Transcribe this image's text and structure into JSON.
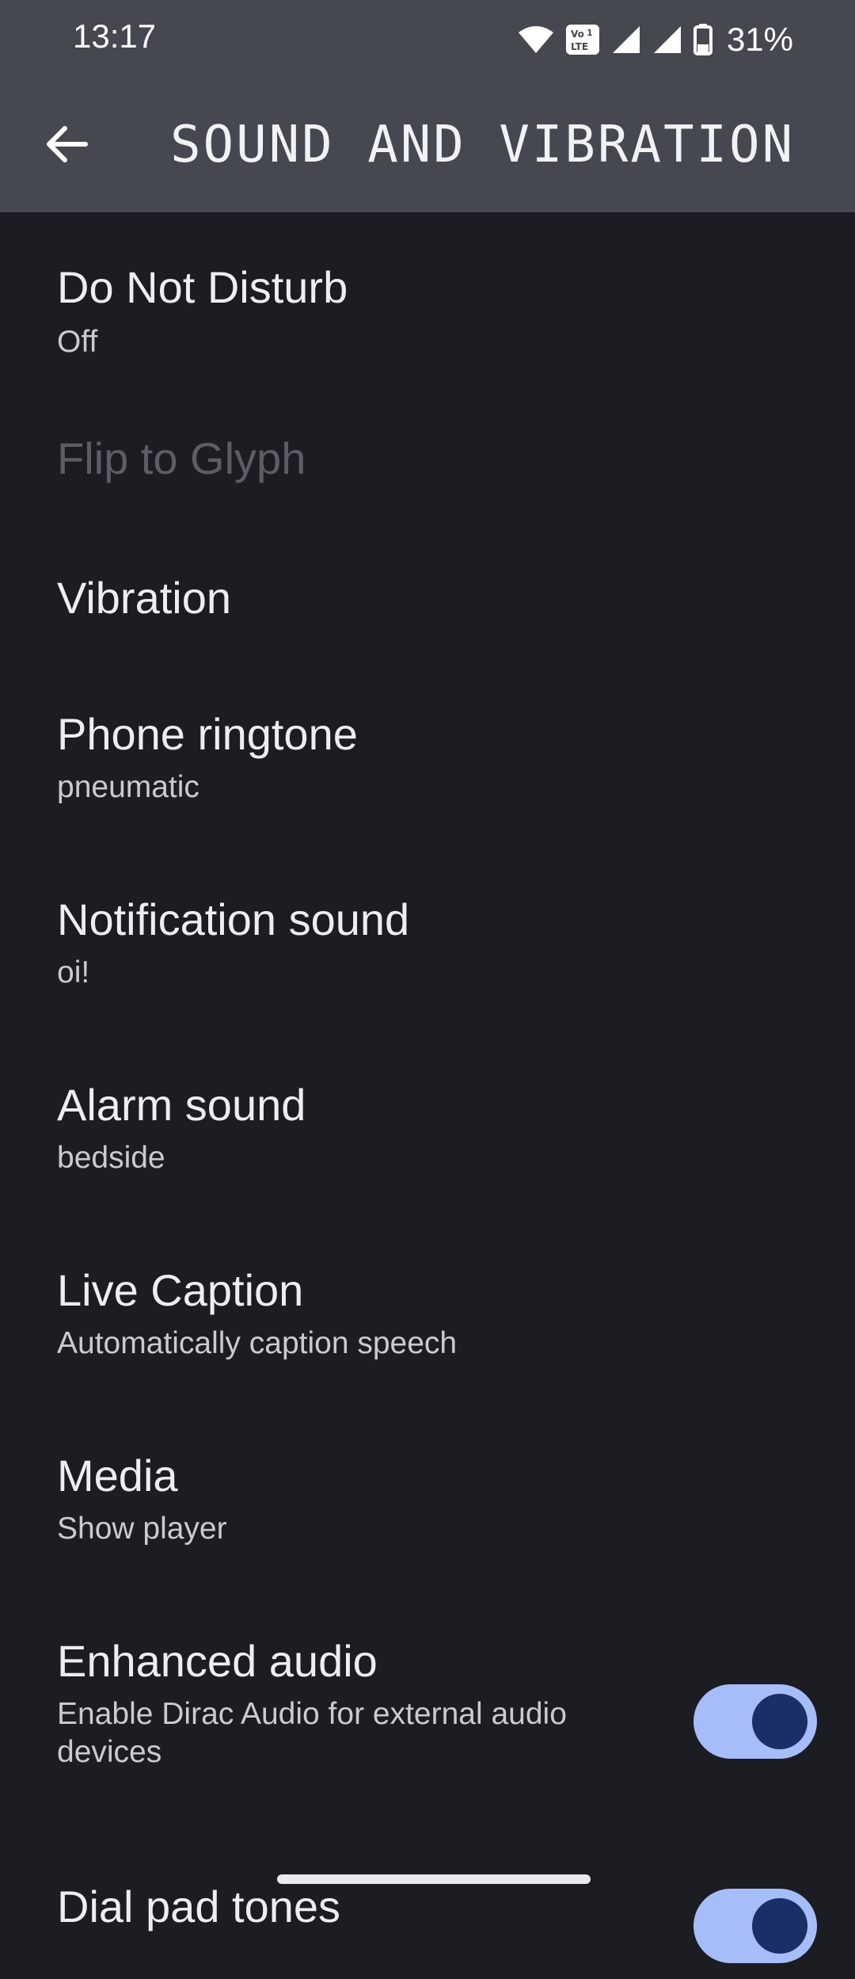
{
  "status_bar": {
    "time": "13:17",
    "battery": "31%",
    "icons": [
      "wifi-icon",
      "volte-icon",
      "signal-icon",
      "signal-icon",
      "battery-icon"
    ]
  },
  "app_bar": {
    "title": "SOUND AND VIBRATION",
    "back_icon": "arrow-left-icon"
  },
  "items": [
    {
      "title": "Do Not Disturb",
      "subtitle": "Off"
    },
    {
      "title": "Flip to Glyph",
      "disabled": true
    },
    {
      "title": "Vibration"
    },
    {
      "title": "Phone ringtone",
      "subtitle": "pneumatic"
    },
    {
      "title": "Notification sound",
      "subtitle": "oi!"
    },
    {
      "title": "Alarm sound",
      "subtitle": "bedside"
    },
    {
      "title": "Live Caption",
      "subtitle": "Automatically caption speech"
    },
    {
      "title": "Media",
      "subtitle": "Show player"
    },
    {
      "title": "Enhanced audio",
      "subtitle": "Enable Dirac Audio for external audio devices",
      "toggle_on": true
    },
    {
      "title": "Dial pad tones",
      "toggle_on": true
    }
  ],
  "colors": {
    "app_bar": "#454851",
    "background": "#1c1d22",
    "toggle_track": "#a7bdf9",
    "toggle_knob": "#1b2e66"
  }
}
